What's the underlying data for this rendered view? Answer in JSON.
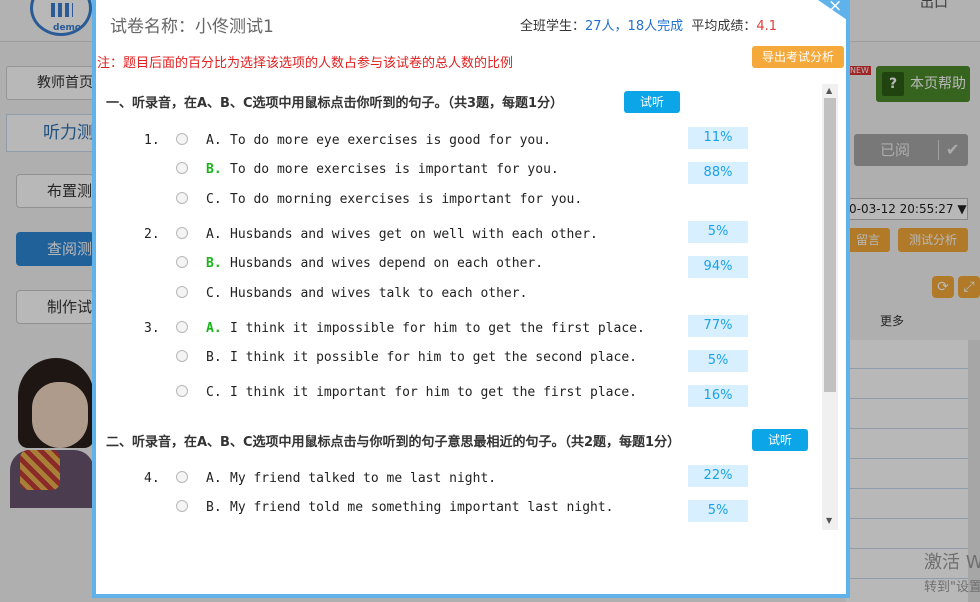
{
  "background": {
    "logo_text": "demo",
    "teacher_home_tab": "教师首页",
    "listening_tab": "听力测",
    "side_buttons": [
      "布置测",
      "查阅测",
      "制作试"
    ],
    "help_label": "本页帮助",
    "help_q": "?",
    "new_badge": "NEW",
    "read_label": "已阅",
    "read_check": "✔",
    "date_value": "0-03-12 20:55:27 ▼",
    "leave_msg": "留言",
    "test_analysis": "测试分析",
    "more": "更多",
    "topright_text": "出口",
    "watermark_line1": "激活 W",
    "watermark_line2": "转到\"设置"
  },
  "modal": {
    "title": "试卷名称：小佟测试1",
    "close_symbol": "×",
    "stats": {
      "class_label": "全班学生：",
      "class_value": "27人，18人完成",
      "avg_label": "平均成绩：",
      "avg_value": "4.1"
    },
    "note": "注：题目后面的百分比为选择该选项的人数占参与该试卷的总人数的比例",
    "export_label": "导出考试分析",
    "sections": [
      {
        "title": "一、听录音，在A、B、C选项中用鼠标点击你听到的句子。（共3题，每题1分）",
        "listen_label": "试听",
        "questions": [
          {
            "number": "1.",
            "options": [
              {
                "letter": "A.",
                "text": "To do more eye exercises is good for you.",
                "percent": "11%",
                "correct": false
              },
              {
                "letter": "B.",
                "text": "To do more exercises is important for you.",
                "percent": "88%",
                "correct": true
              },
              {
                "letter": "C.",
                "text": "To do morning exercises is important for you.",
                "percent": "",
                "correct": false
              }
            ]
          },
          {
            "number": "2.",
            "options": [
              {
                "letter": "A.",
                "text": "Husbands and wives get on well with each other.",
                "percent": "5%",
                "correct": false
              },
              {
                "letter": "B.",
                "text": "Husbands and wives depend on each other.",
                "percent": "94%",
                "correct": true
              },
              {
                "letter": "C.",
                "text": "Husbands and wives talk to each other.",
                "percent": "",
                "correct": false
              }
            ]
          },
          {
            "number": "3.",
            "options": [
              {
                "letter": "A.",
                "text": "I think it impossible for him to get the first place.",
                "percent": "77%",
                "correct": true
              },
              {
                "letter": "B.",
                "text": "I think it possible for him to get the second place.",
                "percent": "5%",
                "correct": false
              },
              {
                "letter": "C.",
                "text": "I think it important for him to get the first place.",
                "percent": "16%",
                "correct": false
              }
            ]
          }
        ]
      },
      {
        "title": "二、听录音，在A、B、C选项中用鼠标点击与你听到的句子意思最相近的句子。（共2题，每题1分）",
        "listen_label": "试听",
        "questions": [
          {
            "number": "4.",
            "options": [
              {
                "letter": "A.",
                "text": "My friend talked to me last night.",
                "percent": "22%",
                "correct": false
              },
              {
                "letter": "B.",
                "text": "My friend told me something important last night.",
                "percent": "5%",
                "correct": false
              }
            ]
          }
        ]
      }
    ]
  },
  "colors": {
    "accent_blue": "#5fb2ea",
    "listen_button": "#0ca6e8",
    "export_button": "#f4a93a",
    "correct_letter": "#19b419",
    "note_red": "#e02020"
  }
}
